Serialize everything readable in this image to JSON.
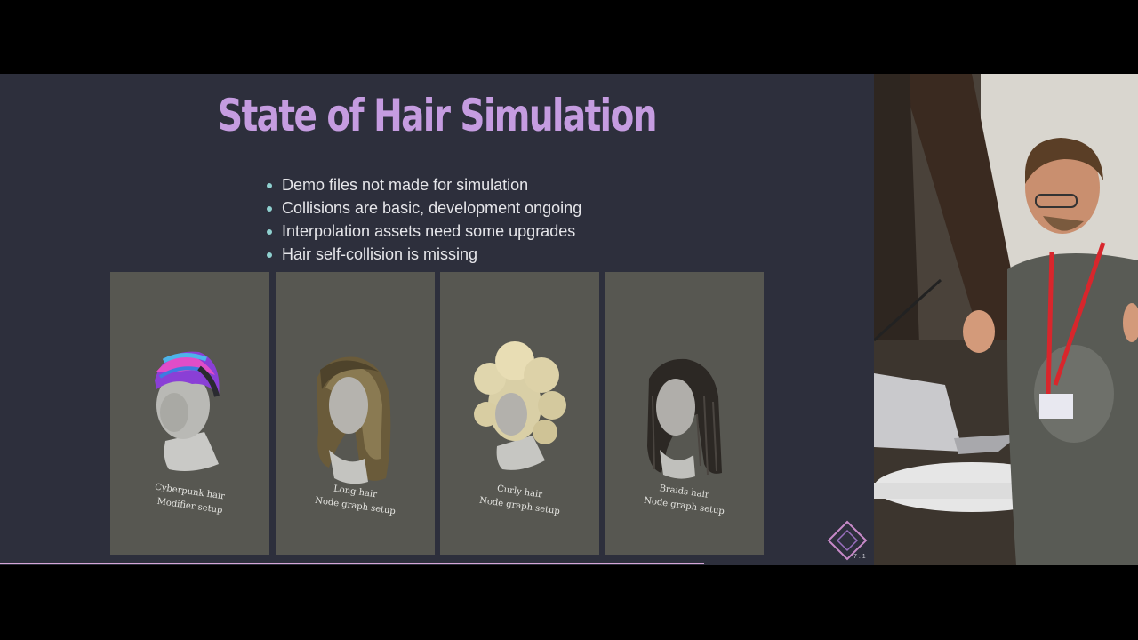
{
  "slide": {
    "title": "State of Hair Simulation",
    "bullets": [
      "Demo files not made for simulation",
      "Collisions are basic, development ongoing",
      "Interpolation assets need some upgrades",
      "Hair self-collision is missing"
    ],
    "panels": [
      {
        "name": "Cyberpunk hair",
        "setup": "Modifier setup"
      },
      {
        "name": "Long hair",
        "setup": "Node graph setup"
      },
      {
        "name": "Curly hair",
        "setup": "Node graph setup"
      },
      {
        "name": "Braids hair",
        "setup": "Node graph setup"
      }
    ],
    "page_number": "7 . 1",
    "colors": {
      "background": "#2d2f3c",
      "title": "#c59ce0",
      "bullet_dot": "#8fd0cf",
      "panel": "#575751",
      "progress": "#d6a6d8"
    }
  },
  "camera": {
    "description_icons": [
      "speaker-photo",
      "laptop-icon",
      "microphone-icon"
    ]
  }
}
